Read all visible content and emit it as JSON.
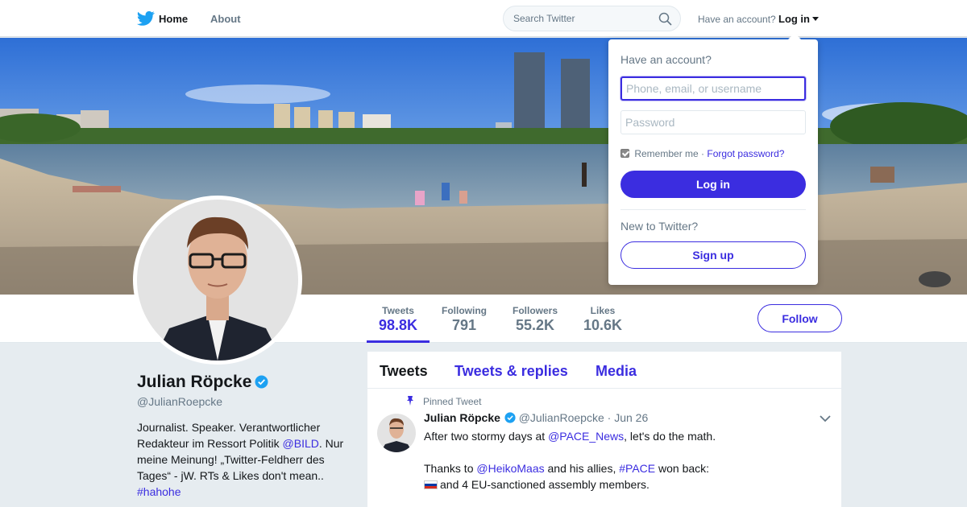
{
  "nav": {
    "home_label": "Home",
    "about_label": "About",
    "search_placeholder": "Search Twitter",
    "have_account_label": "Have an account?",
    "login_label": "Log in"
  },
  "profile_nav": {
    "stats": [
      {
        "label": "Tweets",
        "value": "98.8K"
      },
      {
        "label": "Following",
        "value": "791"
      },
      {
        "label": "Followers",
        "value": "55.2K"
      },
      {
        "label": "Likes",
        "value": "10.6K"
      }
    ],
    "follow_label": "Follow"
  },
  "profile": {
    "name": "Julian Röpcke",
    "handle": "@JulianRoepcke",
    "bio_part1": "Journalist. Speaker. Verantwortlicher Redakteur im Ressort Politik ",
    "bio_link1": "@BILD",
    "bio_part2": ". Nur meine Meinung! „Twitter-Feldherr des Tages“ - jW. RTs & Likes don't mean..",
    "bio_hashtag": "#hahohe"
  },
  "timeline": {
    "tabs": [
      "Tweets",
      "Tweets & replies",
      "Media"
    ],
    "pinned_label": "Pinned Tweet",
    "tweet": {
      "name": "Julian Röpcke",
      "handle": "@JulianRoepcke",
      "separator": "·",
      "date": "Jun 26",
      "line1_a": "After two stormy days at ",
      "line1_link": "@PACE_News",
      "line1_b": ", let's do the math.",
      "line2_a": "Thanks to ",
      "line2_link": "@HeikoMaas",
      "line2_b": " and his allies, ",
      "line2_hashtag": "#PACE",
      "line2_c": " won back:",
      "line3": "and 4 EU-sanctioned assembly members."
    }
  },
  "login_dropdown": {
    "title": "Have an account?",
    "username_placeholder": "Phone, email, or username",
    "password_placeholder": "Password",
    "remember_label": "Remember me",
    "separator": "·",
    "forgot_label": "Forgot password?",
    "login_button": "Log in",
    "new_label": "New to Twitter?",
    "signup_button": "Sign up"
  },
  "colors": {
    "accent": "#3b2de0",
    "verified": "#1da1f2",
    "muted": "#657786",
    "page_bg": "#e6ecf0"
  }
}
